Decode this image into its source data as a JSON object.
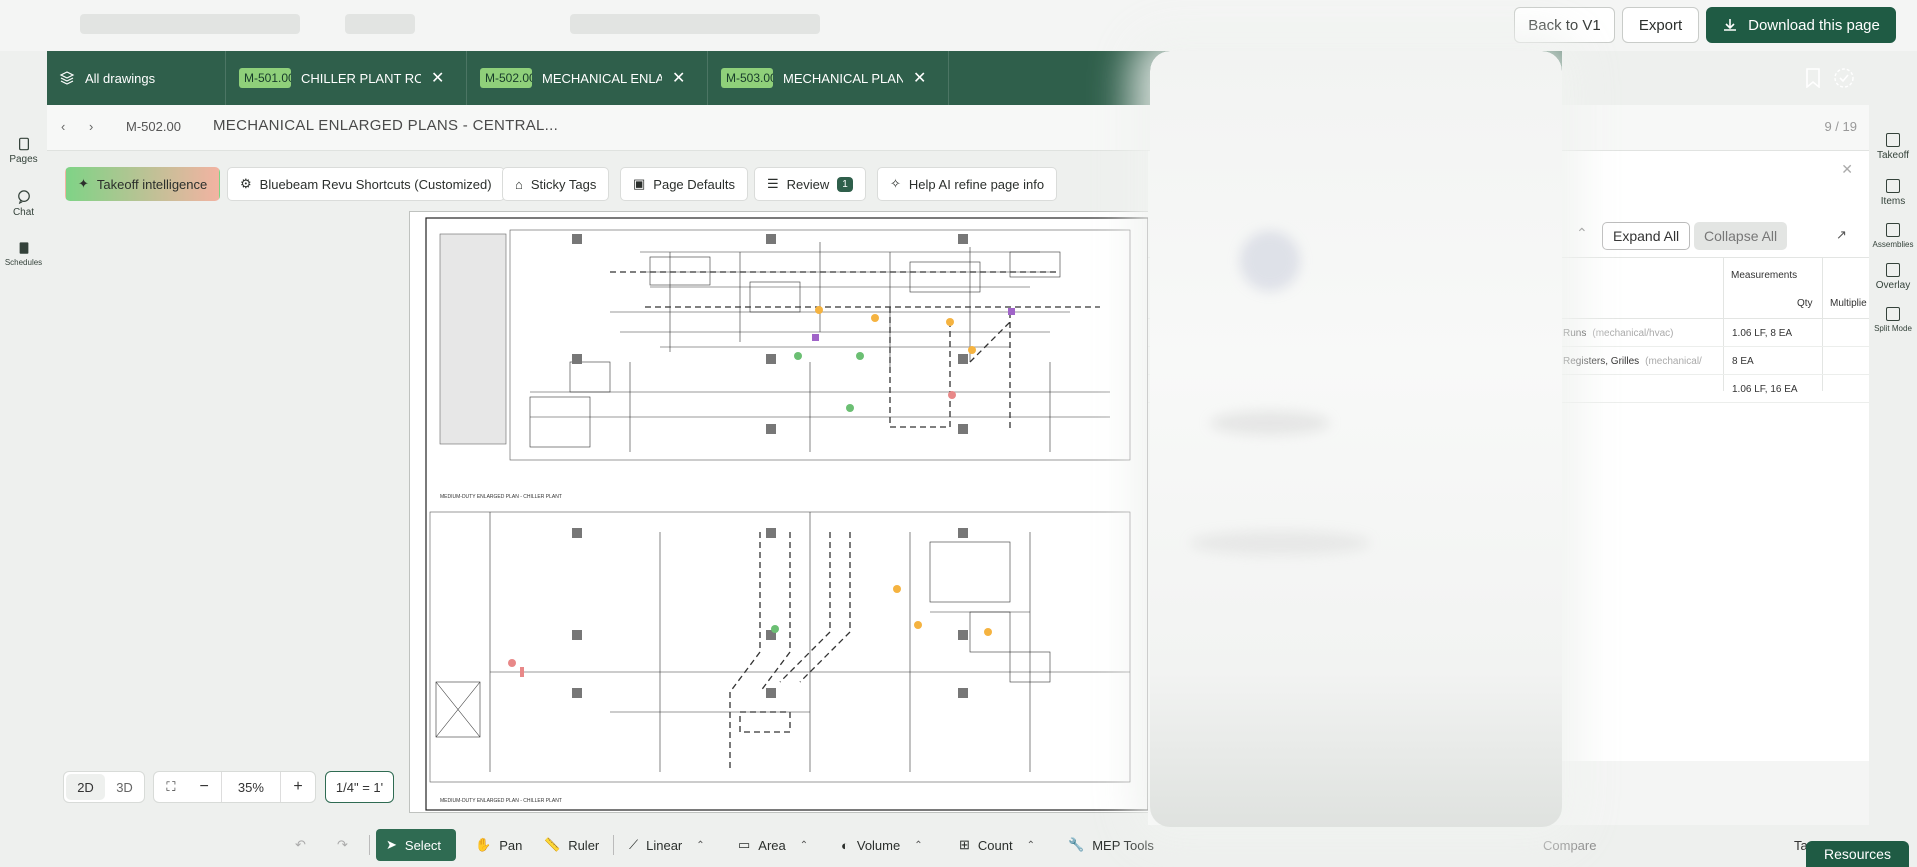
{
  "topbar": {
    "back_label": "Back to V1",
    "export_label": "Export",
    "download_label": "Download this page"
  },
  "left_rail": {
    "items": [
      {
        "label": "Pages",
        "icon": "pages-icon"
      },
      {
        "label": "Chat",
        "icon": "chat-icon"
      },
      {
        "label": "Schedules",
        "icon": "schedules-icon"
      }
    ]
  },
  "tabs": {
    "all_label": "All drawings",
    "items": [
      {
        "code": "M-501.00",
        "title": "CHILLER PLANT ROOM"
      },
      {
        "code": "M-502.00",
        "title": "MECHANICAL ENLARGED"
      },
      {
        "code": "M-503.00",
        "title": "MECHANICAL PLANS"
      }
    ]
  },
  "header": {
    "sheet_no": "M-502.00",
    "title": "MECHANICAL ENLARGED PLANS - CENTRAL..."
  },
  "chips": {
    "takeoff": "Takeoff intelligence",
    "shortcuts": "Bluebeam Revu Shortcuts (Customized)",
    "sticky": "Sticky Tags",
    "defaults": "Page Defaults",
    "review": "Review",
    "review_count": "1",
    "help": "Help AI refine page info"
  },
  "drawing": {
    "plan_label_upper": "MEDIUM-DUTY ENLARGED PLAN - CHILLER PLANT",
    "plan_label_lower": "MEDIUM-DUTY ENLARGED PLAN - CHILLER PLANT"
  },
  "zoom": {
    "mode_2d": "2D",
    "mode_3d": "3D",
    "level": "35%",
    "scale": "1/4\" = 1'"
  },
  "bottom_tools": {
    "select": "Select",
    "pan": "Pan",
    "ruler": "Ruler",
    "linear": "Linear",
    "area": "Area",
    "volume": "Volume",
    "count": "Count",
    "mep": "MEP Tools",
    "compare": "Compare",
    "take": "Ta"
  },
  "right_panel": {
    "page_count": "9 / 19",
    "expand_all": "Expand All",
    "collapse_all": "Collapse All",
    "col_measurements": "Measurements",
    "col_qty": "Qty",
    "col_multiplier": "Multiplie",
    "rows": [
      {
        "name": "Runs",
        "category": "(mechanical/hvac)",
        "meas": "1.06 LF, 8 EA"
      },
      {
        "name": "Registers, Grilles",
        "category": "(mechanical/",
        "meas": "8 EA"
      },
      {
        "name": "",
        "category": "",
        "meas": "1.06 LF, 16 EA"
      }
    ]
  },
  "right_rail": {
    "items": [
      {
        "label": "Takeoff"
      },
      {
        "label": "Items"
      },
      {
        "label": "Assemblies"
      },
      {
        "label": "Overlay"
      },
      {
        "label": "Split Mode"
      }
    ]
  },
  "resources_label": "Resources",
  "colors": {
    "brand": "#2f5f4b",
    "primary_button": "#1f5b44",
    "tab_code_badge": "#8fd07a"
  }
}
